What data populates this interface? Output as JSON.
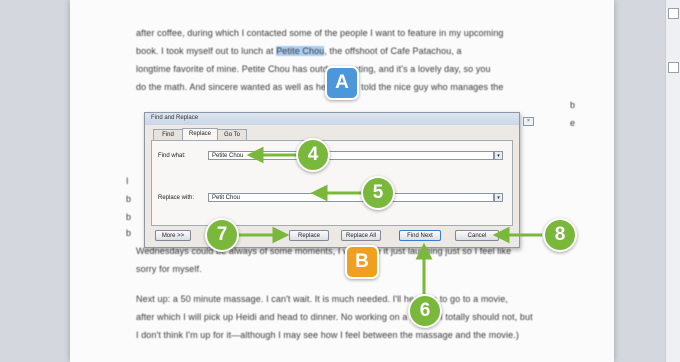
{
  "document": {
    "lines": [
      "after coffee, during which I contacted some of the people I want to feature in my upcoming",
      "book. I took myself out to lunch at Petite Chou, the offshoot of Cafe Patachou, a",
      "longtime favorite of mine. Petite Chou has outdoor seating, and it's a lovely day, so you",
      "do the math. And sincere wanted as well as he could. I told the nice guy who manages the",
      "",
      "",
      "",
      "",
      "",
      "",
      "",
      "",
      "",
      "Wednesdays could be always of some moments, I will make it just laughing just so I feel like",
      "sorry for myself.",
      "",
      "Next up: a 50 minute massage. I can't wait. It is much needed. I'll head on to go to a movie,",
      "after which I will pick up Heidi and head to dinner. No working on a Friday. I totally should not, but",
      "I don't think I'm up for it—although I may see how I feel between the massage and the movie.)"
    ],
    "highlight": "Petite Chou",
    "highlight_prefix": "book. I took myself out to lunch at ",
    "highlight_suffix": ", the offshoot of Cafe Patachou, a",
    "side_fragments": [
      "b",
      "e",
      "I",
      "b",
      "b",
      "b"
    ]
  },
  "dialog": {
    "title": "Find and Replace",
    "title_buttons": [
      "?",
      "×"
    ],
    "tabs": [
      "Find",
      "Replace",
      "Go To"
    ],
    "active_tab": "Replace",
    "find_label": "Find what:",
    "find_value": "Petite Chou",
    "replace_label": "Replace with:",
    "replace_value": "Petit Chou",
    "buttons": {
      "more": "More >>",
      "replace": "Replace",
      "replace_all": "Replace All",
      "find_next": "Find Next",
      "cancel": "Cancel"
    }
  },
  "callouts": {
    "a": "A",
    "b": "B",
    "n4": "4",
    "n5": "5",
    "n6": "6",
    "n7": "7",
    "n8": "8"
  },
  "colors": {
    "callout_green": "#7ab83c",
    "callout_blue": "#4c97d9",
    "callout_orange": "#f0a020",
    "highlight": "#a9cdf2"
  }
}
